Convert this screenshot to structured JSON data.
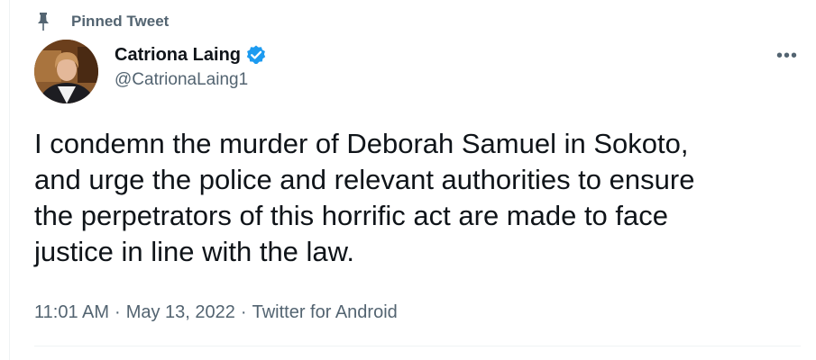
{
  "pinned": {
    "label": "Pinned Tweet",
    "icon": "pin-icon"
  },
  "author": {
    "display_name": "Catriona Laing",
    "handle": "@CatrionaLaing1",
    "verified": true,
    "verified_color": "#1d9bf0"
  },
  "more_menu": {
    "icon": "more-icon",
    "glyph": "•••"
  },
  "tweet": {
    "text": "I condemn the murder of Deborah Samuel in Sokoto,\nand urge the police and relevant authorities to ensure\nthe perpetrators of this horrific act are made to face\njustice in line with the law."
  },
  "meta": {
    "time": "11:01 AM",
    "date": "May 13, 2022",
    "source": "Twitter for Android",
    "separator": "·"
  },
  "colors": {
    "text_primary": "#0f1419",
    "text_secondary": "#536471",
    "divider": "#eff3f4"
  }
}
